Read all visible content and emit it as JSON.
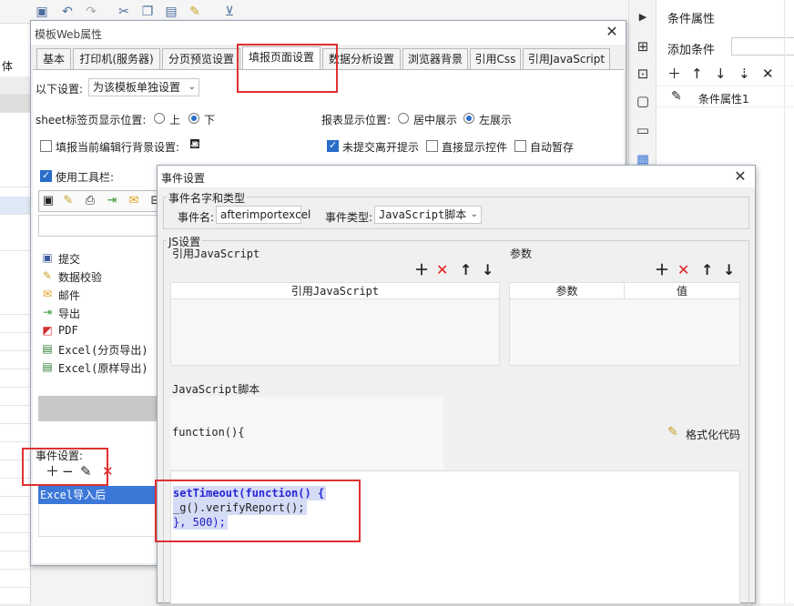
{
  "background_app": {
    "left_strip_label": "体",
    "right_panel": {
      "title": "条件属性",
      "add_label": "添加条件",
      "condition_item": "条件属性1"
    }
  },
  "main_dialog": {
    "title": "模板Web属性",
    "tabs": [
      {
        "label": "基本"
      },
      {
        "label": "打印机(服务器)"
      },
      {
        "label": "分页预览设置"
      },
      {
        "label": "填报页面设置",
        "active": true
      },
      {
        "label": "数据分析设置"
      },
      {
        "label": "浏览器背景"
      },
      {
        "label": "引用Css"
      },
      {
        "label": "引用JavaScript"
      }
    ],
    "settings_scope_label": "以下设置:",
    "settings_scope_value": "为该模板单独设置",
    "sheet_position_label": "sheet标签页显示位置:",
    "sheet_position_options": [
      "上",
      "下"
    ],
    "sheet_position_selected": "下",
    "report_position_label": "报表显示位置:",
    "report_position_options": [
      "居中展示",
      "左展示"
    ],
    "report_position_selected": "左展示",
    "fill_bg_label": "填报当前编辑行背景设置:",
    "fill_bg_checked": false,
    "unsubmitted_leave_label": "未提交离开提示",
    "unsubmitted_leave_checked": true,
    "direct_show_control_label": "直接显示控件",
    "direct_show_control_checked": false,
    "auto_save_label": "自动暂存",
    "auto_save_checked": false,
    "use_toolbar_label": "使用工具栏:",
    "use_toolbar_checked": true,
    "toolbar_items": [
      {
        "label": "提交",
        "icon": "submit-icon"
      },
      {
        "label": "数据校验",
        "icon": "verify-icon"
      },
      {
        "label": "邮件",
        "icon": "mail-icon"
      },
      {
        "label": "导出",
        "icon": "export-icon"
      },
      {
        "label": "PDF",
        "icon": "pdf-icon"
      },
      {
        "label": "Excel(分页导出)",
        "icon": "excel-icon"
      },
      {
        "label": "Excel(原样导出)",
        "icon": "excel-icon"
      }
    ],
    "event_settings_label": "事件设置:",
    "event_list": [
      "Excel导入后"
    ]
  },
  "event_dialog": {
    "title": "事件设置",
    "name_type_group": "事件名字和类型",
    "event_name_label": "事件名:",
    "event_name_value": "afterimportexcel",
    "event_type_label": "事件类型:",
    "event_type_value": "JavaScript脚本",
    "js_settings_group": "JS设置",
    "ref_js_label": "引用JavaScript",
    "ref_js_column": "引用JavaScript",
    "params_label": "参数",
    "params_columns": [
      "参数",
      "值"
    ],
    "js_script_label": "JavaScript脚本",
    "function_signature": "function(){",
    "format_code_label": "格式化代码",
    "code_lines": [
      "setTimeout(function() {",
      "_g().verifyReport();",
      "}, 500);"
    ]
  },
  "colors": {
    "accent": "#3c78d8",
    "highlight_border": "#e03030",
    "delete_red": "#e02020",
    "selection_bg": "#d5dcf6"
  }
}
